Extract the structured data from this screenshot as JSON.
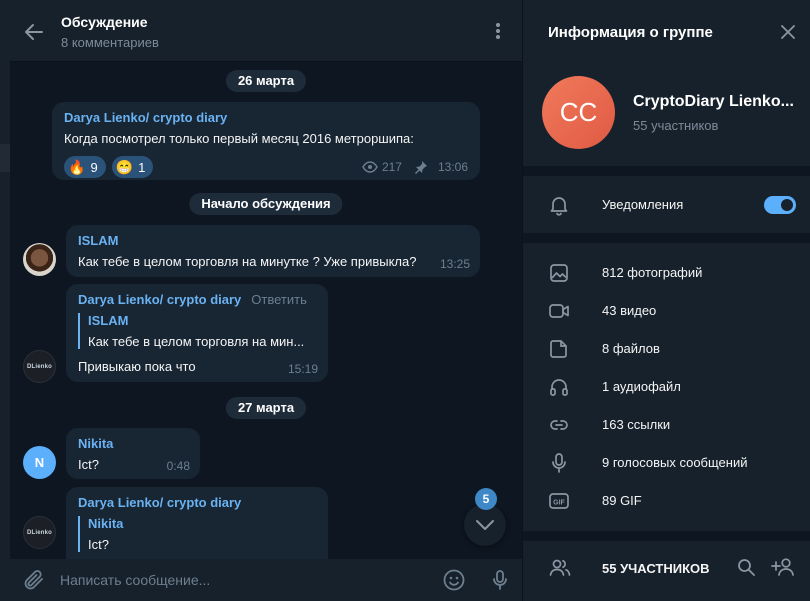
{
  "chat": {
    "title": "Обсуждение",
    "subtitle": "8 комментариев",
    "dates": [
      "26 марта",
      "Начало обсуждения",
      "27 марта"
    ],
    "messages": [
      {
        "author": "Darya Lienko/ crypto diary",
        "text": "Когда посмотрел только первый месяц 2016 метроршипа:",
        "reactions": [
          {
            "emoji": "🔥",
            "count": "9"
          },
          {
            "emoji": "😁",
            "count": "1"
          }
        ],
        "views": "217",
        "time": "13:06"
      },
      {
        "author": "ISLAM",
        "text": "Как тебе в целом торговля на минутке ? Уже привыкла?",
        "time": "13:25"
      },
      {
        "author": "Darya Lienko/ crypto diary",
        "reply_label": "Ответить",
        "quote_author": "ISLAM",
        "quote_text": "Как тебе в целом торговля на мин...",
        "text": "Привыкаю пока что",
        "time": "15:19"
      },
      {
        "author": "Nikita",
        "avatar_letter": "N",
        "text": "Ict?",
        "time": "0:48"
      },
      {
        "author": "Darya Lienko/ crypto diary",
        "quote_author": "Nikita",
        "quote_text": "Ict?"
      }
    ],
    "avatar_logo_text": "DLienko",
    "unread_count": "5",
    "composer_placeholder": "Написать сообщение..."
  },
  "info": {
    "title": "Информация о группе",
    "group_initials": "CC",
    "group_name": "CryptoDiary Lienko...",
    "group_members": "55 участников",
    "notifications_label": "Уведомления",
    "notifications_on": true,
    "media": [
      {
        "icon": "photo-icon",
        "label": "812 фотографий"
      },
      {
        "icon": "video-icon",
        "label": "43 видео"
      },
      {
        "icon": "file-icon",
        "label": "8 файлов"
      },
      {
        "icon": "headphones-icon",
        "label": "1 аудиофайл"
      },
      {
        "icon": "link-icon",
        "label": "163 ссылки"
      },
      {
        "icon": "microphone-icon",
        "label": "9 голосовых сообщений"
      },
      {
        "icon": "gif-icon",
        "label": "89 GIF"
      }
    ],
    "members_title": "55 УЧАСТНИКОВ"
  },
  "colors": {
    "accent": "#5caffa",
    "author_name": "#6ab2f2",
    "bubble": "#182533",
    "background": "#0e1621",
    "panel": "#17212b",
    "group_avatar": "#e8684d"
  }
}
